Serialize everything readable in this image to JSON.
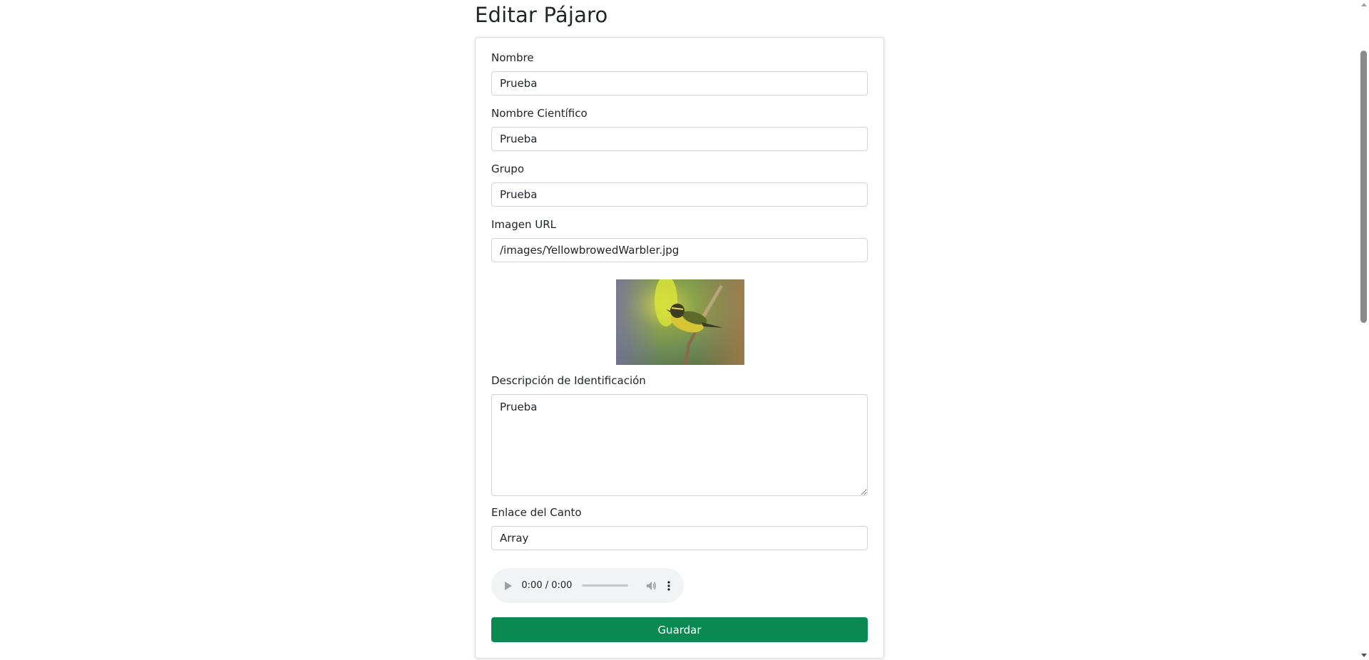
{
  "page": {
    "title": "Editar Pájaro"
  },
  "form": {
    "nombre": {
      "label": "Nombre",
      "value": "Prueba"
    },
    "nombre_cientifico": {
      "label": "Nombre Científico",
      "value": "Prueba"
    },
    "grupo": {
      "label": "Grupo",
      "value": "Prueba"
    },
    "imagen_url": {
      "label": "Imagen URL",
      "value": "/images/YellowbrowedWarbler.jpg"
    },
    "descripcion": {
      "label": "Descripción de Identificación",
      "value": "Prueba"
    },
    "enlace_canto": {
      "label": "Enlace del Canto",
      "value": "Array"
    },
    "audio": {
      "time": "0:00 / 0:00",
      "progress": 0
    },
    "save_label": "Guardar"
  },
  "colors": {
    "save_button": "#0a8a52",
    "audio_bg": "#f1f3f4"
  },
  "icons": {
    "audio_play": "play-icon",
    "audio_volume": "volume-icon",
    "audio_more": "more-vertical-icon",
    "image": "bird-photo"
  }
}
